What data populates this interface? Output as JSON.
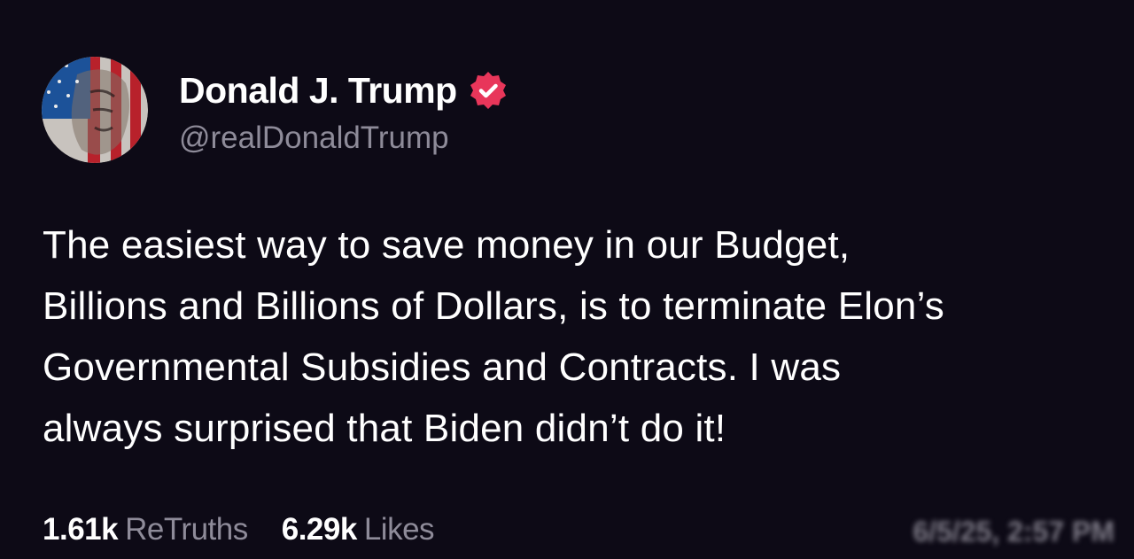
{
  "author": {
    "display_name": "Donald J. Trump",
    "handle": "@realDonaldTrump",
    "verified_icon": "verified-badge-icon",
    "verified_color": "#e8365a"
  },
  "post": {
    "lines": [
      "The easiest way to save money in our Budget,",
      "Billions and Billions of Dollars, is to terminate Elon’s",
      "Governmental Subsidies and Contracts. I was",
      "always surprised that Biden didn’t do it!"
    ]
  },
  "stats": {
    "retruths_count": "1.61k",
    "retruths_label": "ReTruths",
    "likes_count": "6.29k",
    "likes_label": "Likes"
  },
  "timestamp": "6/5/25, 2:57 PM",
  "colors": {
    "background": "#0d0a16",
    "primary_text": "#ffffff",
    "secondary_text": "#8e8b99"
  }
}
